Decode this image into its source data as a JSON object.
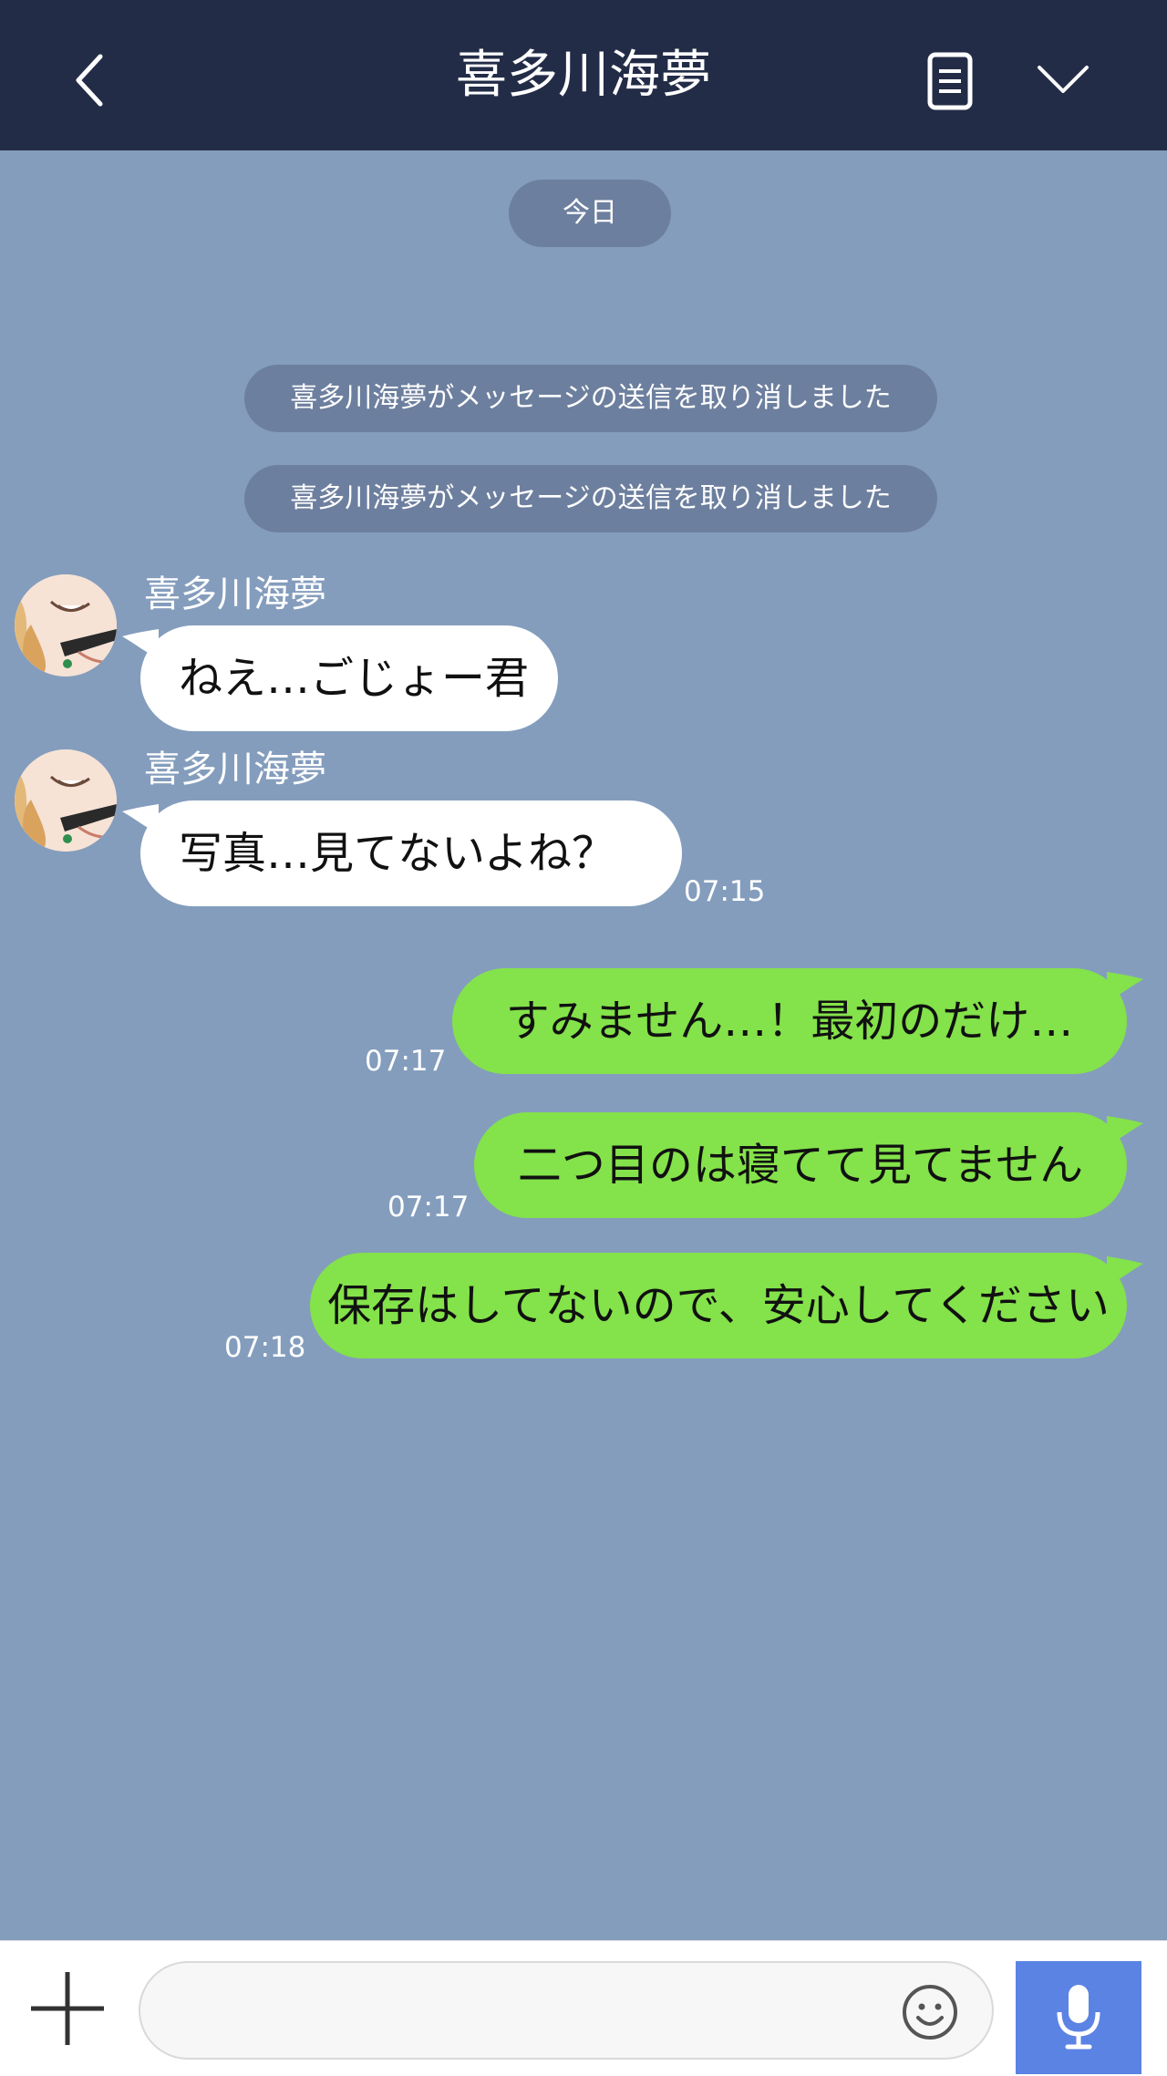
{
  "header": {
    "title": "喜多川海夢",
    "back_icon": "chevron-left-icon",
    "notes_icon": "note-icon",
    "menu_icon": "chevron-down-icon"
  },
  "date_label": "今日",
  "notices": [
    "喜多川海夢がメッセージの送信を取り消しました",
    "喜多川海夢がメッセージの送信を取り消しました"
  ],
  "incoming": [
    {
      "sender": "喜多川海夢",
      "text": "ねえ…ごじょー君",
      "time": ""
    },
    {
      "sender": "喜多川海夢",
      "text": "写真…見てないよね？",
      "time": "07:15"
    }
  ],
  "outgoing": [
    {
      "text": "すみません…！最初のだけ…",
      "time": "07:17"
    },
    {
      "text": "二つ目のは寝てて見てません",
      "time": "07:17"
    },
    {
      "text": "保存はしてないので、安心してください",
      "time": "07:18"
    }
  ],
  "input_bar": {
    "plus_icon": "plus-icon",
    "emoji_icon": "emoji-icon",
    "mic_icon": "microphone-icon",
    "placeholder": ""
  },
  "colors": {
    "header_bg": "#232c47",
    "chat_bg": "#849dbd",
    "outgoing_bubble": "#84e24a",
    "incoming_bubble": "#ffffff",
    "mic_button": "#5b83e4"
  }
}
